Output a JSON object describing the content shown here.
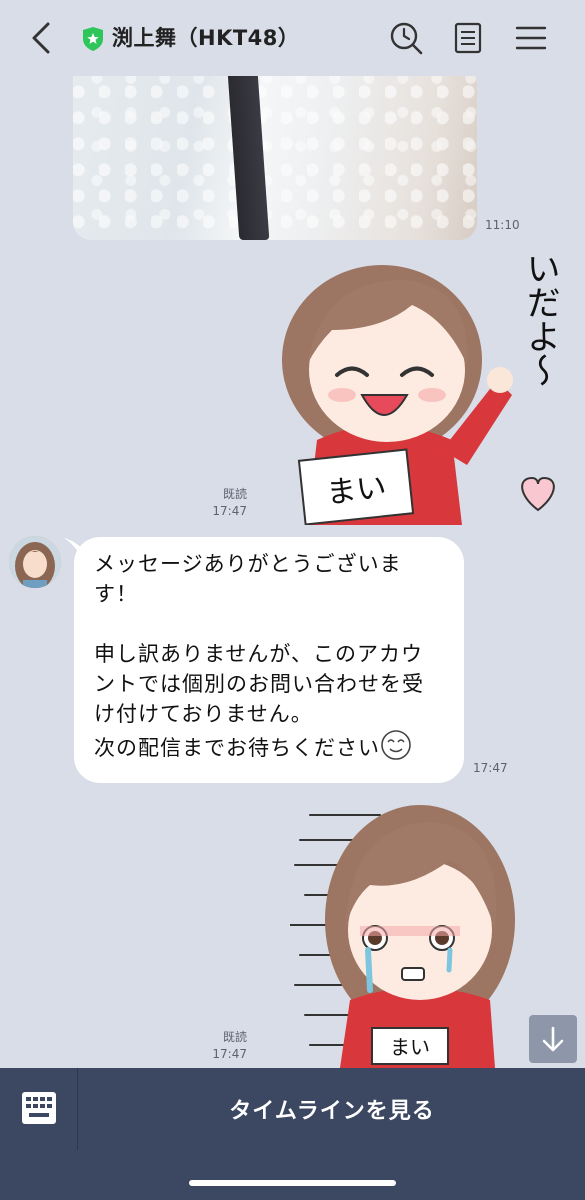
{
  "header": {
    "title": "渕上舞（HKT48）",
    "icons": [
      "back-icon",
      "verified-shield-icon",
      "search-icon",
      "notes-icon",
      "menu-icon"
    ]
  },
  "messages": {
    "photo": {
      "time": "11:10"
    },
    "sticker1": {
      "read": "既読",
      "time": "17:47",
      "sticker_text": "まいだよ〜",
      "name_tag": "まい"
    },
    "reply": {
      "line1": "メッセージありがとうございま",
      "line2": "す！",
      "line3": "申し訳ありませんが、このアカウ",
      "line4": "ントでは個別のお問い合わせを受",
      "line5": "け付けておりません。",
      "line6": "次の配信までお待ちください",
      "time": "17:47"
    },
    "sticker2": {
      "read": "既読",
      "time": "17:47",
      "name_tag": "まい"
    }
  },
  "bottom_bar": {
    "timeline_label": "タイムラインを見る",
    "icons": [
      "keyboard-icon",
      "scroll-down-icon"
    ]
  },
  "colors": {
    "background": "#d9dde8",
    "bottom_bar": "#3c4762",
    "verified_green": "#2ec55a",
    "sticker_red": "#d8373b"
  }
}
